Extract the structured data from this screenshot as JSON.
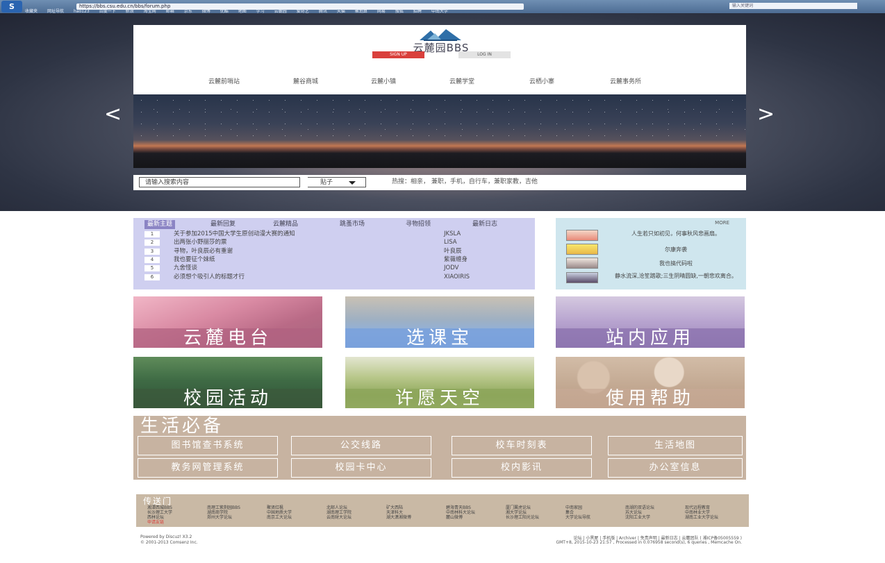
{
  "browser": {
    "url": "https://bbs.csu.edu.cn/bbs/forum.php",
    "search_placeholder": "输入关键词",
    "bookmarks": [
      "收藏夹",
      "网址导航",
      "hao123",
      "百度一下",
      "新浪",
      "淘宝网",
      "邮箱",
      "京东",
      "微博",
      "优酷",
      "地图",
      "学习",
      "云麓园",
      "爱奇艺",
      "腾讯",
      "天猫",
      "聚划算",
      "网易",
      "搜狐",
      "招聘",
      "中南大学"
    ]
  },
  "site": {
    "name": "云麓园BBS",
    "signup_label": "SIGN UP",
    "login_label": "LOG IN",
    "nav": [
      "云麓前哨站",
      "麓谷商城",
      "云麓小镇",
      "云麓学堂",
      "云栖小寨",
      "云麓事务所"
    ],
    "prev_arrow": "<",
    "next_arrow": ">"
  },
  "search": {
    "placeholder": "请输入搜索内容",
    "type": "贴子",
    "hot": "热搜：相亲， 兼职，手机，自行车，兼职家教，吉他"
  },
  "threads": {
    "tabs": [
      "最新主题",
      "最新回复",
      "云麓精品",
      "跳蚤市场",
      "寻物招领",
      "最新日志"
    ],
    "items": [
      {
        "num": "1",
        "title": "关于参加2015中国大学生原创动漫大赛的通知",
        "author": "JKSLA"
      },
      {
        "num": "2",
        "title": "出两张小野丽莎的票",
        "author": "LISA"
      },
      {
        "num": "3",
        "title": "寻物，叶良辰必有重谢",
        "author": "叶良辰"
      },
      {
        "num": "4",
        "title": "我也要征个妹纸",
        "author": "紫薇缠身"
      },
      {
        "num": "5",
        "title": "九舍怪谈",
        "author": "JODV"
      },
      {
        "num": "6",
        "title": "必须想个吸引人的标题才行",
        "author": "XIAOIRIS"
      }
    ]
  },
  "users": {
    "more_label": "MORE",
    "items": [
      {
        "quote": "人生若只如初见，何事秋风悲画扇。"
      },
      {
        "quote": "尔康奔袭"
      },
      {
        "quote": "我也搞代码啦"
      },
      {
        "quote": "静水流深,沧笙踏歌;三生阴晴圆缺,一朝悲欢离合。"
      }
    ]
  },
  "tiles": [
    "云麓电台",
    "选课宝",
    "站内应用",
    "校园活动",
    "许愿天空",
    "使用帮助"
  ],
  "life": {
    "title": "生活必备",
    "links": [
      "图书馆查书系统",
      "公交线路",
      "校车时刻表",
      "生活地图",
      "教务网管理系统",
      "校园卡中心",
      "校内影讯",
      "办公室信息"
    ]
  },
  "portal": {
    "title": "传送门",
    "links": [
      "湘潭西城BBS",
      "南理工紫荆园BBS",
      "聚贤红枫",
      "北邮人论坛",
      "矿大西陆",
      "碧海青天BBS",
      "厦门翼虎论坛",
      "中南家园",
      "南湖的双语论坛",
      "现代远程教育",
      "长沙理工大学",
      "湖南商学院",
      "中国地质大学",
      "湖南理工学院",
      "天津科大",
      "中南林科大论坛",
      "湘大学论坛",
      "集合",
      "苏大论坛",
      "中南林业大学",
      "西林论坛",
      "郑州大学论坛",
      "南京工大论坛",
      "云南财大论坛",
      "湖大潇湘微博",
      "麓山微博",
      "长沙理工阳光论坛",
      "大学论坛导航",
      "沈阳工业大学",
      "湖南工业大学论坛",
      "申请友链"
    ]
  },
  "footer": {
    "powered": "Powered by Discuz! X3.2",
    "copyright": "© 2001-2013 Comsenz Inc.",
    "links": "论坛 | 小黑屋 | 手机版 | Archiver | 免责声明 | 最新日志 | 云麓团队 ( 湘ICP备05005559 ) ",
    "stats": "GMT+8, 2015-10-23 21:57 , Processed in 0.076958 second(s), 6 queries , Memcache On."
  },
  "colors": {
    "accent_signup": "#d9403c",
    "threads_bg": "#cfcff0",
    "users_bg": "#cfe6ee",
    "life_bg": "#c7b3a1"
  }
}
